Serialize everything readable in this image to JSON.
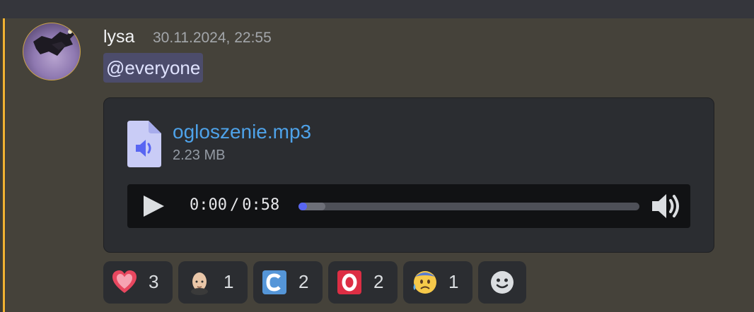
{
  "message": {
    "author": "lysa",
    "timestamp": "30.11.2024, 22:55",
    "content": "@everyone",
    "accent_color": "#f0b232",
    "mention_color": "#4c4c6b"
  },
  "attachment": {
    "file_name": "ogloszenie.mp3",
    "file_size": "2.23 MB",
    "icon": "audio-file-icon",
    "link_color": "#4ea2e9"
  },
  "player": {
    "current_time": "0:00",
    "separator": "/",
    "duration": "0:58",
    "progress": 0.0,
    "progress_color": "#5865f2",
    "play_icon": "play-icon",
    "volume_icon": "volume-icon"
  },
  "reactions": [
    {
      "emoji": "heart",
      "count": "3"
    },
    {
      "emoji": "bald-man",
      "count": "1"
    },
    {
      "emoji": "letter-c",
      "count": "2"
    },
    {
      "emoji": "letter-o",
      "count": "2"
    },
    {
      "emoji": "anxious-face-with-sweat",
      "count": "1"
    }
  ],
  "add_reaction_icon": "smiley-add-icon"
}
